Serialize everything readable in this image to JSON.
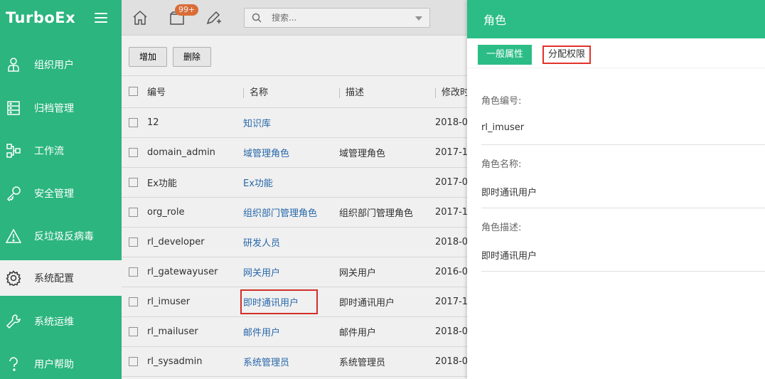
{
  "app": {
    "logo": "TurboEx"
  },
  "sidebar": {
    "items": [
      {
        "label": "组织用户",
        "icon": "user-org-icon"
      },
      {
        "label": "归档管理",
        "icon": "archive-icon"
      },
      {
        "label": "工作流",
        "icon": "workflow-icon"
      },
      {
        "label": "安全管理",
        "icon": "key-icon"
      },
      {
        "label": "反垃圾反病毒",
        "icon": "warning-icon"
      },
      {
        "label": "系统配置",
        "icon": "gear-icon",
        "active": true
      },
      {
        "label": "系统运维",
        "icon": "wrench-icon"
      },
      {
        "label": "用户帮助",
        "icon": "help-icon"
      }
    ]
  },
  "topbar": {
    "badge": "99+",
    "search_placeholder": "搜索..."
  },
  "toolbar": {
    "add_label": "增加",
    "delete_label": "删除"
  },
  "table": {
    "headers": [
      "编号",
      "名称",
      "描述",
      "修改时"
    ],
    "rows": [
      {
        "code": "12",
        "name": "知识库",
        "desc": "",
        "date": "2018-0"
      },
      {
        "code": "domain_admin",
        "name": "域管理角色",
        "desc": "域管理角色",
        "date": "2017-1"
      },
      {
        "code": "Ex功能",
        "name": "Ex功能",
        "desc": "",
        "date": "2017-0"
      },
      {
        "code": "org_role",
        "name": "组织部门管理角色",
        "desc": "组织部门管理角色",
        "date": "2017-1"
      },
      {
        "code": "rl_developer",
        "name": "研发人员",
        "desc": "",
        "date": "2018-0"
      },
      {
        "code": "rl_gatewayuser",
        "name": "网关用户",
        "desc": "网关用户",
        "date": "2016-0"
      },
      {
        "code": "rl_imuser",
        "name": "即时通讯用户",
        "desc": "即时通讯用户",
        "date": "2017-1"
      },
      {
        "code": "rl_mailuser",
        "name": "邮件用户",
        "desc": "邮件用户",
        "date": "2018-0"
      },
      {
        "code": "rl_sysadmin",
        "name": "系统管理员",
        "desc": "系统管理员",
        "date": "2018-0"
      }
    ]
  },
  "panel": {
    "title": "角色",
    "tab_general": "一般属性",
    "tab_permissions": "分配权限",
    "fields": [
      {
        "label": "角色编号:",
        "value": "rl_imuser"
      },
      {
        "label": "角色名称:",
        "value": "即时通讯用户"
      },
      {
        "label": "角色描述:",
        "value": "即时通讯用户"
      }
    ]
  }
}
